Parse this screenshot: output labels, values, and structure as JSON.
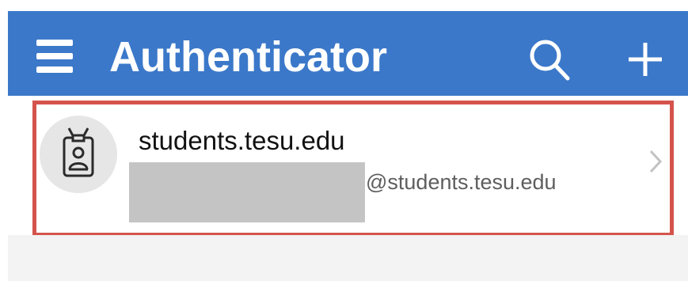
{
  "app_bar": {
    "title": "Authenticator",
    "menu_icon": "hamburger-menu-icon",
    "search_icon": "search-icon",
    "add_icon": "plus-icon",
    "background_color": "#3b78c9"
  },
  "account": {
    "organization": "students.tesu.edu",
    "email_suffix": "@students.tesu.edu",
    "avatar_icon": "id-badge-icon",
    "chevron_icon": "chevron-right-icon",
    "highlight_color": "#d4544c"
  }
}
